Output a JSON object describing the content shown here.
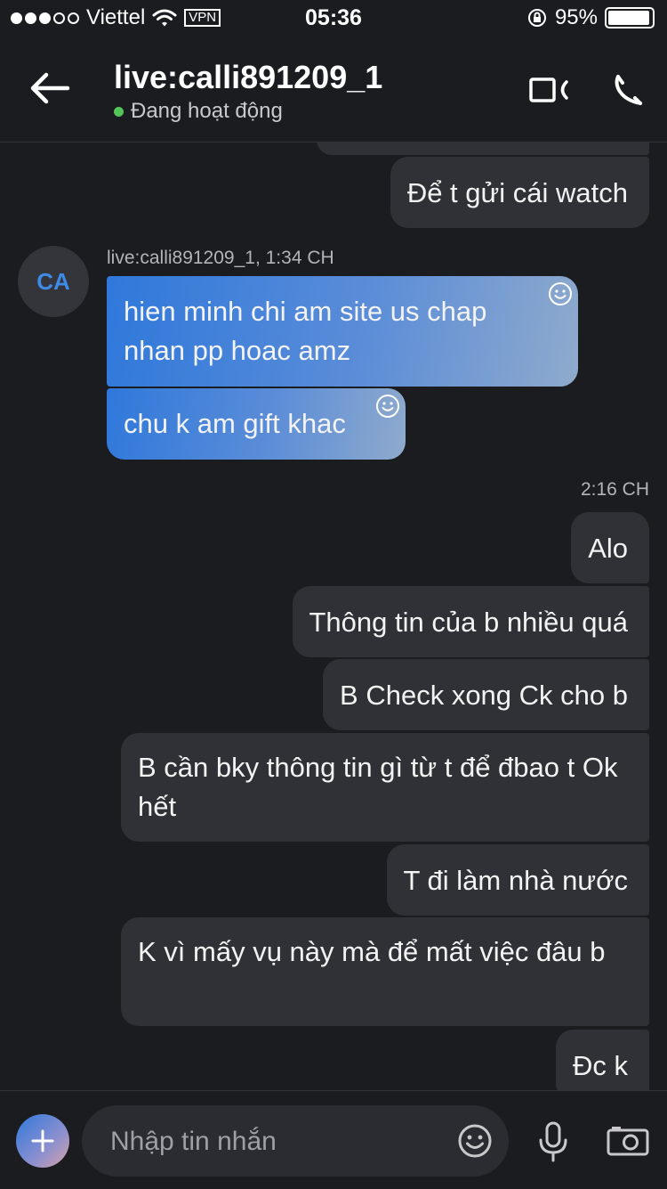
{
  "status_bar": {
    "carrier": "Viettel",
    "vpn": "VPN",
    "time": "05:36",
    "battery_percent": "95%",
    "battery_level": 0.95
  },
  "header": {
    "title": "live:calli891209_1",
    "status": "Đang hoạt động",
    "back_icon": "arrow-left-icon",
    "video_icon": "video-camera-icon",
    "call_icon": "phone-icon"
  },
  "thread": {
    "outgoing_top": "Để t gửi cái watch",
    "incoming": {
      "avatar_initials": "CA",
      "sender": "live:calli891209_1, 1:34 CH",
      "messages": [
        "hien minh chi am site us chap nhan pp hoac amz",
        "chu k am gift khac"
      ]
    },
    "timestamp": "2:16 CH",
    "outgoing": [
      "Alo",
      "Thông tin của b nhiều quá",
      "B Check xong Ck cho b",
      "B cần bky thông tin gì từ t để đbao t Ok hết",
      "T đi làm nhà nước",
      "K vì mấy vụ này mà để mất việc đâu b",
      "Đc k"
    ]
  },
  "composer": {
    "placeholder": "Nhập tin nhắn",
    "icons": [
      "plus-icon",
      "emoji-icon",
      "microphone-icon",
      "camera-icon"
    ]
  },
  "colors": {
    "background": "#1b1c1f",
    "outgoing_bubble": "#303136",
    "incoming_gradient_start": "#2f78db",
    "incoming_gradient_end": "#8faacc",
    "online": "#52c458",
    "avatar_text": "#3e8ae6"
  }
}
